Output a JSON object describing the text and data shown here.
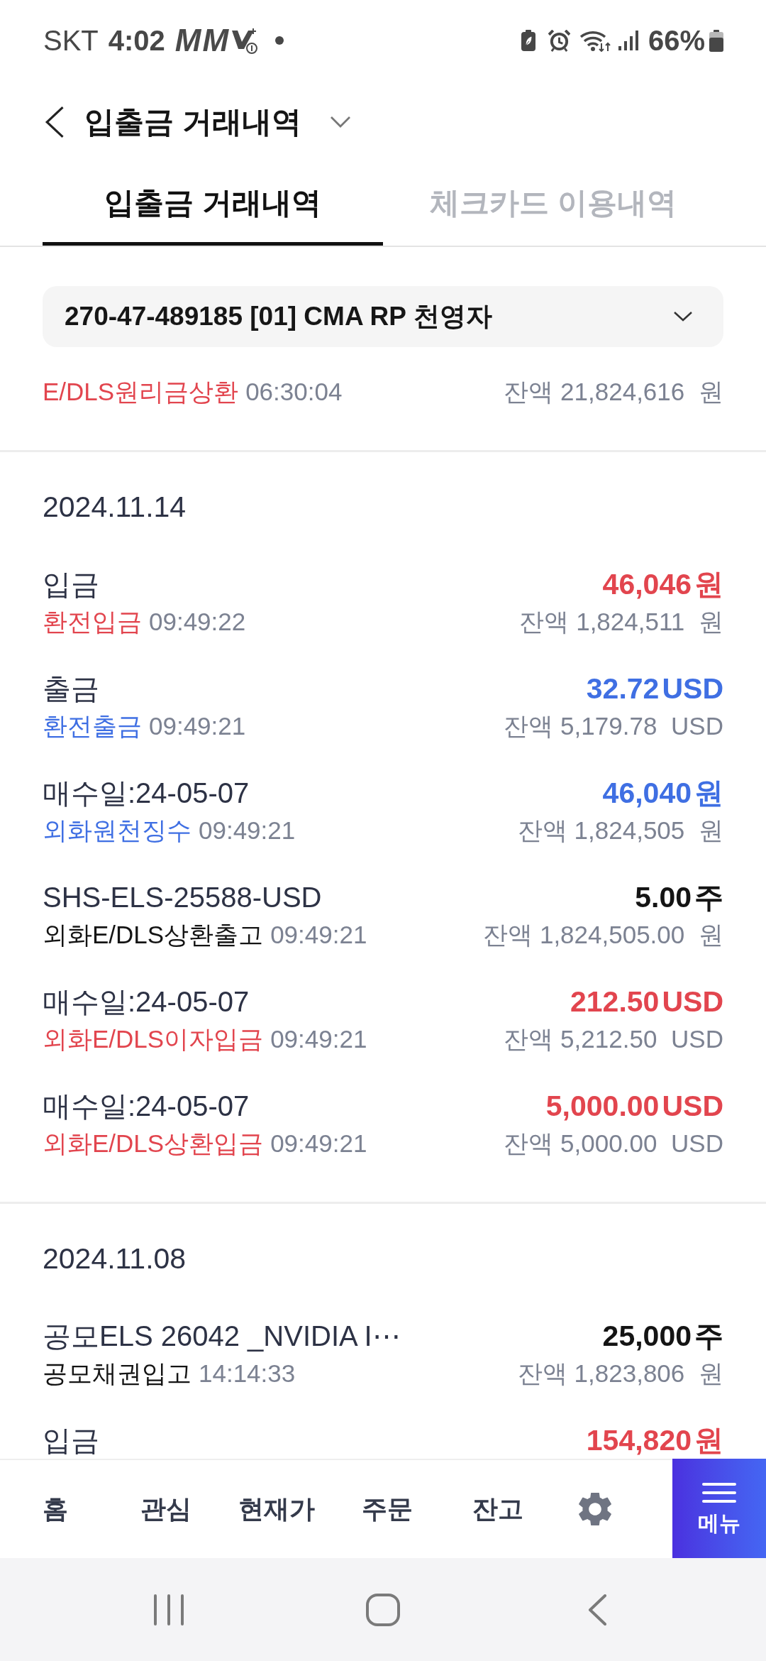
{
  "status_bar": {
    "carrier": "SKT",
    "time": "4:02",
    "notification_glyphs": [
      "M",
      "M"
    ],
    "battery": "66%"
  },
  "header": {
    "title": "입출금 거래내역"
  },
  "tabs": [
    {
      "label": "입출금 거래내역",
      "selected": true
    },
    {
      "label": "체크카드 이용내역",
      "selected": false
    }
  ],
  "account_selector": {
    "value": "270-47-489185 [01] CMA RP 천영자"
  },
  "partial_row": {
    "kind": "deposit",
    "type": "E/DLS원리금상환",
    "time": "06:30:04",
    "balance_label": "잔액",
    "balance": "21,824,616",
    "balance_unit": "원"
  },
  "groups": [
    {
      "date": "2024.11.14",
      "transactions": [
        {
          "title": "입금",
          "kind": "deposit",
          "amount": "46,046",
          "unit": "원",
          "type": "환전입금",
          "time": "09:49:22",
          "balance_label": "잔액",
          "balance": "1,824,511",
          "balance_unit": "원"
        },
        {
          "title": "출금",
          "kind": "withdrawal",
          "amount": "32.72",
          "unit": "USD",
          "type": "환전출금",
          "time": "09:49:21",
          "balance_label": "잔액",
          "balance": "5,179.78",
          "balance_unit": "USD"
        },
        {
          "title": "매수일:24-05-07",
          "kind": "withdrawal",
          "amount": "46,040",
          "unit": "원",
          "type": "외화원천징수",
          "time": "09:49:21",
          "balance_label": "잔액",
          "balance": "1,824,505",
          "balance_unit": "원"
        },
        {
          "title": "SHS-ELS-25588-USD",
          "kind": "securities",
          "amount": "5.00",
          "unit": "주",
          "type": "외화E/DLS상환출고",
          "time": "09:49:21",
          "balance_label": "잔액",
          "balance": "1,824,505.00",
          "balance_unit": "원"
        },
        {
          "title": "매수일:24-05-07",
          "kind": "deposit",
          "amount": "212.50",
          "unit": "USD",
          "type": "외화E/DLS이자입금",
          "time": "09:49:21",
          "balance_label": "잔액",
          "balance": "5,212.50",
          "balance_unit": "USD"
        },
        {
          "title": "매수일:24-05-07",
          "kind": "deposit",
          "amount": "5,000.00",
          "unit": "USD",
          "type": "외화E/DLS상환입금",
          "time": "09:49:21",
          "balance_label": "잔액",
          "balance": "5,000.00",
          "balance_unit": "USD"
        }
      ]
    },
    {
      "date": "2024.11.08",
      "transactions": [
        {
          "title": "공모ELS 26042 _NVIDIA I⋯",
          "kind": "securities",
          "amount": "25,000",
          "unit": "주",
          "type": "공모채권입고",
          "time": "14:14:33",
          "balance_label": "잔액",
          "balance": "1,823,806",
          "balance_unit": "원"
        },
        {
          "title": "입금",
          "kind": "deposit",
          "amount": "154,820",
          "unit": "원"
        }
      ]
    }
  ],
  "bottom_nav": {
    "items": [
      {
        "label": "홈"
      },
      {
        "label": "관심"
      },
      {
        "label": "현재가"
      },
      {
        "label": "주문"
      },
      {
        "label": "잔고"
      }
    ],
    "menu_label": "메뉴"
  }
}
